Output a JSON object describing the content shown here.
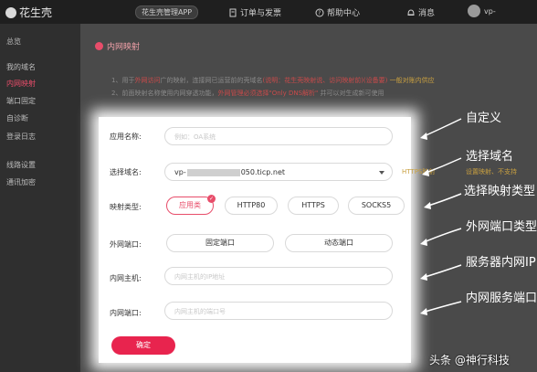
{
  "topbar": {
    "logo_text": "花生壳",
    "app_button": "花生壳管理APP",
    "nav": [
      {
        "label": "订单与发票",
        "icon": "receipt-icon"
      },
      {
        "label": "帮助中心",
        "icon": "help-icon"
      },
      {
        "label": "消息",
        "icon": "bell-icon"
      }
    ],
    "user_label": "vp-"
  },
  "sidebar": {
    "items": [
      {
        "label": "总览",
        "active": false
      },
      {
        "label": "我的域名",
        "active": false
      },
      {
        "label": "内网映射",
        "active": true
      },
      {
        "label": "端口固定",
        "active": false
      },
      {
        "label": "自诊断",
        "active": false
      },
      {
        "label": "登录日志",
        "active": false
      },
      {
        "label": "线路设置",
        "active": false
      },
      {
        "label": "通讯加密",
        "active": false
      }
    ]
  },
  "page": {
    "title": "内网映射",
    "notes": [
      {
        "pre": "1、用于",
        "hl": "外网访问",
        "mid": "广的映射，连接网已运营前的壳域名",
        "or1": "(说明：花生壳映射说、访问映射前)(设备要)",
        "tail": "一般对账内供应"
      },
      {
        "pre": "2、",
        "hl": "",
        "mid": "前面映射名称使用内网穿透功能，",
        "or1": "外网管理必须选择\"Only DNS解析\"",
        "tail": "并可以对生成新可使用"
      }
    ]
  },
  "form": {
    "app_name_label": "应用名称:",
    "app_name_placeholder": "例如：OA系统",
    "domain_label": "选择域名:",
    "domain_prefix": "vp-",
    "domain_suffix": "050.ticp.net",
    "domain_hint_right": "HTTPS映射",
    "domain_hint_right2": "设置映射、不支持",
    "type_label": "映射类型:",
    "types": [
      {
        "label": "应用类",
        "selected": true
      },
      {
        "label": "HTTP80",
        "selected": false
      },
      {
        "label": "HTTPS",
        "selected": false
      },
      {
        "label": "SOCKS5",
        "selected": false
      }
    ],
    "ext_port_label": "外网端口:",
    "ext_port_options": [
      "固定端口",
      "动态端口"
    ],
    "host_label": "内网主机:",
    "host_placeholder": "内网主机的IP地址",
    "port_label": "内网端口:",
    "port_placeholder": "内网主机的端口号",
    "confirm_button": "确定"
  },
  "annotations": [
    "自定义",
    "选择域名",
    "选择映射类型",
    "外网端口类型",
    "服务器内网IP",
    "内网服务端口"
  ],
  "watermark": "头条 @神行科技",
  "colors": {
    "accent": "#e8244e",
    "dim_bg": "#4a4a4a",
    "topbar": "#1f1f1f"
  }
}
